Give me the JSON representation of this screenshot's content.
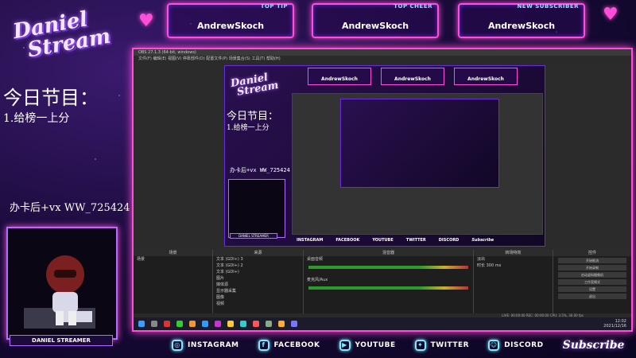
{
  "logo": {
    "line1": "Daniel",
    "line2": "Stream"
  },
  "top_panels": [
    {
      "tag": "TOP TIP",
      "name": "AndrewSkoch"
    },
    {
      "tag": "TOP CHEER",
      "name": "AndrewSkoch"
    },
    {
      "tag": "NEW SUBSCRIBER",
      "name": "AndrewSkoch"
    }
  ],
  "agenda": {
    "title": "今日节目：",
    "item": "1.给榜一上分"
  },
  "contact": "办卡后+vx WW_725424",
  "camera_badge": "DANIEL STREAMER",
  "screen": {
    "window_title": "OBS 27.1.3 (64-bit, windows)",
    "menu": "文件(F)  编辑(E)  视图(V)  停靠部件(D)  配置文件(P)  场景集合(S)  工具(T)  帮助(H)",
    "preview": {
      "logo1": "Daniel",
      "logo2": "Stream",
      "title": "今日节目：",
      "item": "1.给榜一上分",
      "contact": "办卡后+vx WW_725424",
      "badge": "DANIEL STREAMER",
      "panels": [
        "AndrewSkoch",
        "AndrewSkoch",
        "AndrewSkoch"
      ],
      "social": [
        "INSTAGRAM",
        "FACEBOOK",
        "YOUTUBE",
        "TWITTER",
        "DISCORD"
      ],
      "subscribe": "Subscribe"
    },
    "docks": {
      "scenes": {
        "title": "场景",
        "items": [
          "场景"
        ]
      },
      "sources": {
        "title": "来源",
        "items": [
          "文本 (GDI+) 3",
          "文本 (GDI+) 2",
          "文本 (GDI+)",
          "图片",
          "媒体源",
          "显示器采集",
          "图像",
          "视频"
        ]
      },
      "mixer": {
        "title": "混音器",
        "tracks": [
          "桌面音频",
          "麦克风/Aux"
        ]
      },
      "transitions": {
        "title": "转场特效",
        "fade": "淡出",
        "duration": "时长",
        "duration_value": "300 ms"
      },
      "controls": {
        "title": "控件",
        "buttons": [
          "开始推流",
          "开始录制",
          "启动虚拟摄像机",
          "工作室模式",
          "设置",
          "退出"
        ]
      }
    },
    "status": "LIVE: 00:00:00   REC: 00:00:00   CPU: 3.5%, 30.00 fps",
    "clock": {
      "time": "12:02",
      "date": "2021/12/16"
    }
  },
  "social_links": [
    {
      "icon": "instagram-icon",
      "label": "INSTAGRAM"
    },
    {
      "icon": "facebook-icon",
      "label": "FACEBOOK"
    },
    {
      "icon": "youtube-icon",
      "label": "YOUTUBE"
    },
    {
      "icon": "twitter-icon",
      "label": "TWITTER"
    },
    {
      "icon": "discord-icon",
      "label": "DISCORD"
    }
  ],
  "subscribe": "Subscribe",
  "colors": {
    "neon_pink": "#ff4fd8",
    "neon_purple": "#b36bff",
    "neon_cyan": "#7fe9ff",
    "bg_dark": "#1a0b3a"
  }
}
